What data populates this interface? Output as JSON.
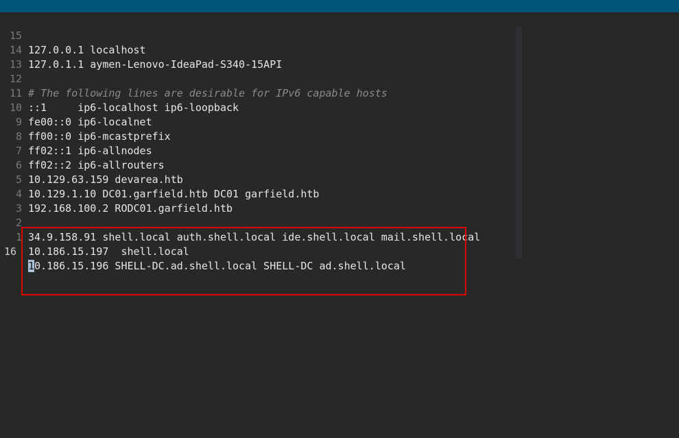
{
  "colors": {
    "titlebar": "#005577",
    "background": "#282828",
    "highlight_box": "#e00000",
    "cursor": "#a8c0d8"
  },
  "lines": [
    {
      "num": "15",
      "text": "127.0.0.1 localhost"
    },
    {
      "num": "14",
      "text": "127.0.1.1 aymen-Lenovo-IdeaPad-S340-15API"
    },
    {
      "num": "13",
      "text": ""
    },
    {
      "num": "12",
      "text": "# The following lines are desirable for IPv6 capable hosts"
    },
    {
      "num": "11",
      "text": "::1     ip6-localhost ip6-loopback"
    },
    {
      "num": "10",
      "text": "fe00::0 ip6-localnet"
    },
    {
      "num": "9",
      "text": "ff00::0 ip6-mcastprefix"
    },
    {
      "num": "8",
      "text": "ff02::1 ip6-allnodes"
    },
    {
      "num": "7",
      "text": "ff02::2 ip6-allrouters"
    },
    {
      "num": "6",
      "text": "10.129.63.159 devarea.htb"
    },
    {
      "num": "5",
      "text": "10.129.1.10 DC01.garfield.htb DC01 garfield.htb"
    },
    {
      "num": "4",
      "text": "192.168.100.2 RODC01.garfield.htb"
    },
    {
      "num": "3",
      "text": ""
    },
    {
      "num": "2",
      "text": "34.9.158.91 shell.local auth.shell.local ide.shell.local mail.shell.local"
    },
    {
      "num": "1",
      "text": "10.186.15.197  shell.local"
    }
  ],
  "current_line": {
    "num": "16",
    "cursor_char": "1",
    "rest": "0.186.15.196 SHELL-DC.ad.shell.local SHELL-DC ad.shell.local"
  }
}
